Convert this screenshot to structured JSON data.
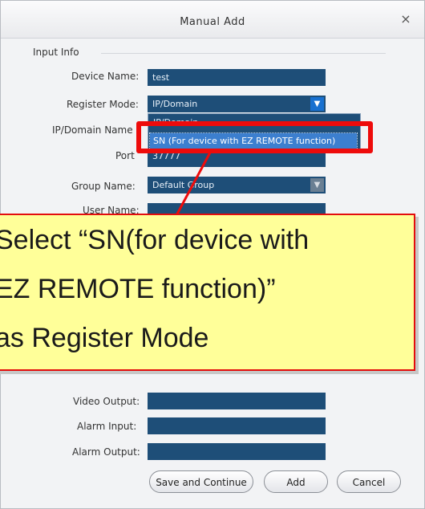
{
  "dialog": {
    "title": "Manual Add",
    "close_symbol": "×",
    "section_title": "Input Info"
  },
  "form": {
    "device_name_label": "Device Name:",
    "device_name_value": "test",
    "register_mode_label": "Register Mode:",
    "register_mode_value": "IP/Domain",
    "ip_domain_label": "IP/Domain Name",
    "port_label": "Port",
    "port_partial": "37777",
    "group_name_label": "Group Name:",
    "group_name_value": "Default Group",
    "user_name_label": "User Name:",
    "video_output_label": "Video Output:",
    "alarm_input_label": "Alarm Input:",
    "alarm_output_label": "Alarm Output:"
  },
  "dropdown": {
    "options": [
      "IP/Domain",
      "SN (For device with EZ REMOTE function)"
    ],
    "selected_index": 1
  },
  "buttons": {
    "save_continue": "Save and Continue",
    "add": "Add",
    "cancel": "Cancel"
  },
  "callout": {
    "line1": "Select “SN(for device with",
    "line2": "EZ REMOTE function)”",
    "line3": "as Register Mode"
  },
  "colors": {
    "field_bg": "#1e4e78",
    "highlight": "#ee0b0b",
    "callout_bg": "#ffff99"
  },
  "icons": {
    "close": "close-icon",
    "dropdown_arrow": "chevron-down-icon"
  }
}
